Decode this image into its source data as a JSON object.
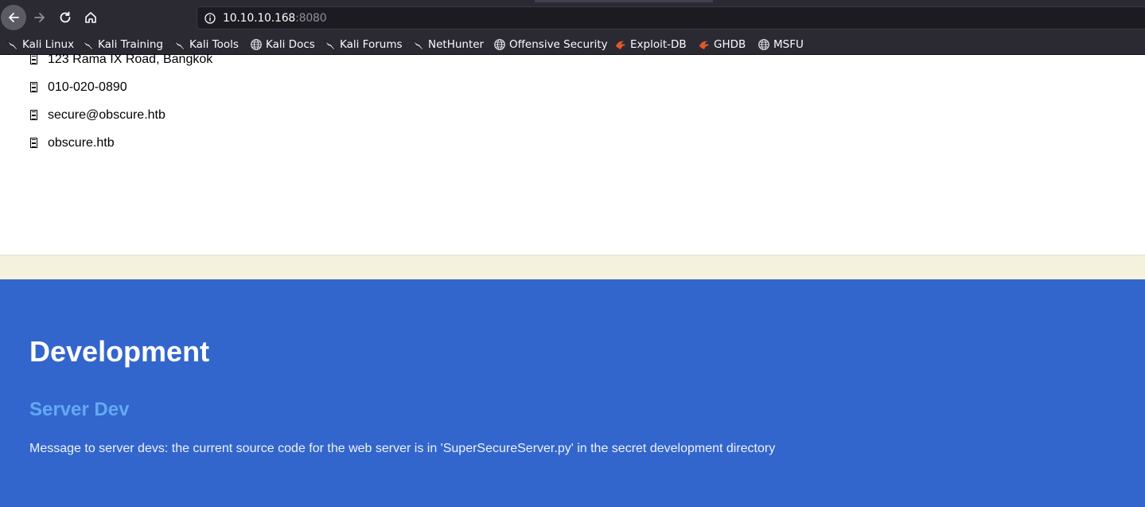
{
  "browser": {
    "url_host": "10.10.10.168",
    "url_port": ":8080",
    "bookmarks": [
      {
        "label": "Kali Linux",
        "icon": "kali-dragon-icon"
      },
      {
        "label": "Kali Training",
        "icon": "kali-dragon-icon"
      },
      {
        "label": "Kali Tools",
        "icon": "kali-dragon-icon"
      },
      {
        "label": "Kali Docs",
        "icon": "globe-icon"
      },
      {
        "label": "Kali Forums",
        "icon": "kali-dragon-icon"
      },
      {
        "label": "NetHunter",
        "icon": "kali-dragon-icon"
      },
      {
        "label": "Offensive Security",
        "icon": "globe-icon"
      },
      {
        "label": "Exploit-DB",
        "icon": "exploit-db-icon"
      },
      {
        "label": "GHDB",
        "icon": "exploit-db-icon"
      },
      {
        "label": "MSFU",
        "icon": "globe-icon"
      }
    ]
  },
  "contact": {
    "items": [
      {
        "text": "123 Rama IX Road, Bangkok",
        "icon": "missing-glyph-icon"
      },
      {
        "text": "010-020-0890",
        "icon": "missing-glyph-icon"
      },
      {
        "text": "secure@obscure.htb",
        "icon": "missing-glyph-icon"
      },
      {
        "text": "obscure.htb",
        "icon": "missing-glyph-icon"
      }
    ]
  },
  "development": {
    "title": "Development",
    "subtitle": "Server Dev",
    "message": "Message to server devs: the current source code for the web server is in 'SuperSecureServer.py' in the secret development directory"
  },
  "colors": {
    "chrome_bg": "#2b2a33",
    "dev_bg": "#3366cc",
    "subtitle": "#64a8f4",
    "beige_band": "#f4f2dc"
  }
}
